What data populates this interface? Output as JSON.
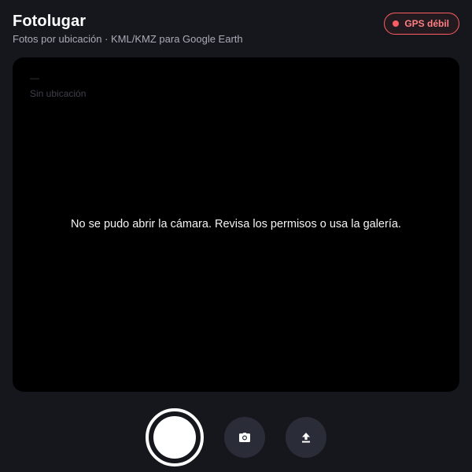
{
  "header": {
    "title": "Fotolugar",
    "subtitle": "Fotos por ubicación · KML/KMZ para Google Earth"
  },
  "gps_status": {
    "label": "GPS débil",
    "color": "#ff5d62"
  },
  "camera_view": {
    "coordinates": "—",
    "location": "Sin ubicación",
    "error_message": "No se pudo abrir la cámara. Revisa los permisos o usa la galería."
  },
  "controls": {
    "shutter": {
      "icon": "shutter-icon"
    },
    "camera_switch": {
      "icon": "camera-icon"
    },
    "upload": {
      "icon": "upload-icon"
    }
  },
  "colors": {
    "background": "#16171c",
    "accent_error": "#ff5d62",
    "button_bg": "#2a2d38"
  }
}
